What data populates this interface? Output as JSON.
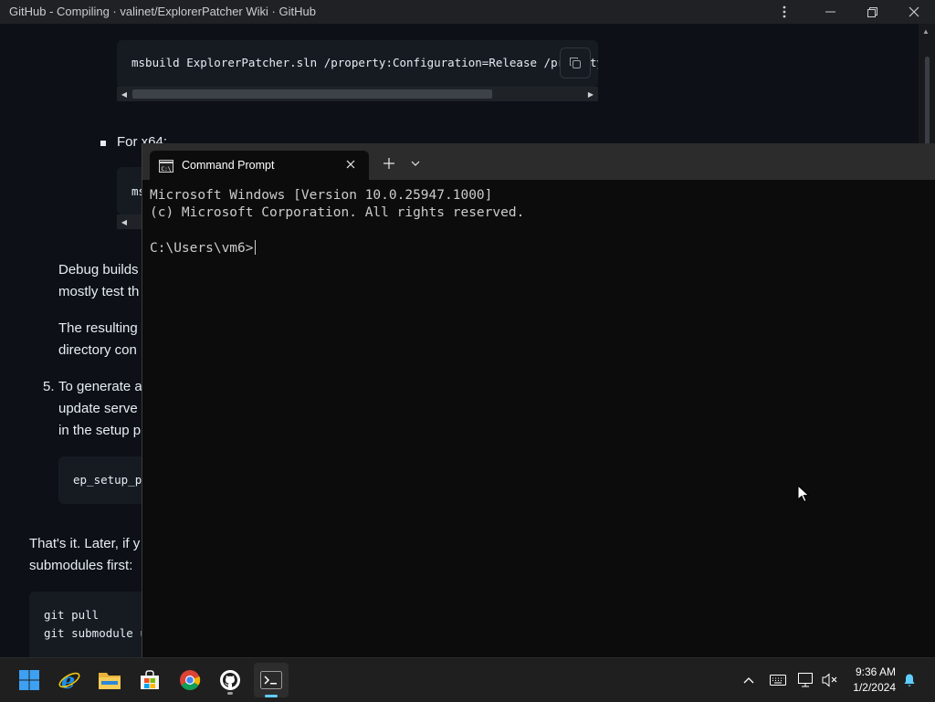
{
  "browser": {
    "title": "GitHub - Compiling · valinet/ExplorerPatcher Wiki · GitHub",
    "menu_icon": "more-vertical-icon",
    "minimize_icon": "minimize-icon",
    "restore_icon": "restore-icon",
    "close_icon": "close-icon"
  },
  "page": {
    "code_block_1": "msbuild ExplorerPatcher.sln /property:Configuration=Release /pr",
    "code_block_1_overflow": "ty",
    "list_item_x64": "For x64:",
    "code_block_2": "ms",
    "para_debug_line1": "Debug builds",
    "para_debug_line2": "mostly test th",
    "para_result_line1": "The resulting",
    "para_result_line2": "directory con",
    "step5_number": "5.",
    "step5_line1": "To generate a",
    "step5_line2": "update serve",
    "step5_line3": "in the setup p",
    "code_block_3": "ep_setup_p",
    "para_later_line1": "That's it. Later, if y",
    "para_later_line2": "submodules first:",
    "code_block_4_line1": "git pull",
    "code_block_4_line2": "git submodule u"
  },
  "terminal": {
    "tab_title": "Command Prompt",
    "line1": "Microsoft Windows [Version 10.0.25947.1000]",
    "line2": "(c) Microsoft Corporation. All rights reserved.",
    "prompt": "C:\\Users\\vm6>"
  },
  "taskbar": {
    "apps": [
      "start-icon",
      "internet-explorer-icon",
      "file-explorer-icon",
      "microsoft-store-icon",
      "chrome-icon",
      "github-desktop-icon",
      "terminal-icon"
    ],
    "tray": [
      "chevron-up-icon",
      "keyboard-icon",
      "network-icon",
      "volume-muted-icon"
    ],
    "time": "9:36 AM",
    "date": "1/2/2024",
    "notification_icon": "bell-icon"
  }
}
